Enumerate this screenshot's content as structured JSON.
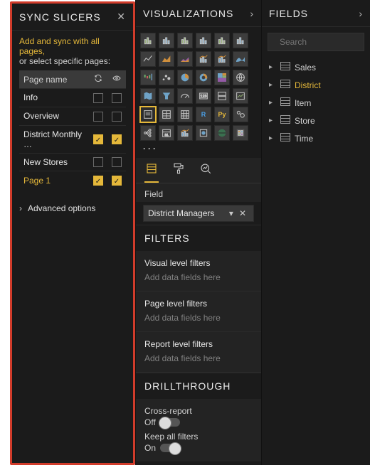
{
  "sync": {
    "title": "SYNC SLICERS",
    "hint1": "Add and sync with all pages,",
    "hint2": "or select specific pages:",
    "col_name": "Page name",
    "rows": [
      {
        "name": "Info",
        "sync": false,
        "visible": false,
        "current": false
      },
      {
        "name": "Overview",
        "sync": false,
        "visible": false,
        "current": false
      },
      {
        "name": "District Monthly …",
        "sync": true,
        "visible": true,
        "current": false
      },
      {
        "name": "New Stores",
        "sync": false,
        "visible": false,
        "current": false
      },
      {
        "name": "Page 1",
        "sync": true,
        "visible": true,
        "current": true
      }
    ],
    "advanced": "Advanced options"
  },
  "viz": {
    "title": "VISUALIZATIONS",
    "section_fields_tab": "Field",
    "field_chip": "District Managers",
    "filters_title": "FILTERS",
    "visual_filters": "Visual level filters",
    "page_filters": "Page level filters",
    "report_filters": "Report level filters",
    "add_placeholder": "Add data fields here",
    "drill_title": "DRILLTHROUGH",
    "cross_report": "Cross-report",
    "cross_report_val": "Off",
    "keep_filters": "Keep all filters",
    "keep_filters_val": "On",
    "icons": [
      "stacked-bar",
      "stacked-column",
      "clustered-bar",
      "clustered-column",
      "100-bar",
      "100-column",
      "line",
      "area",
      "stacked-area",
      "line-stacked",
      "line-clustered",
      "ribbon",
      "waterfall",
      "scatter",
      "pie",
      "donut",
      "treemap",
      "map",
      "filled-map",
      "funnel",
      "gauge",
      "card",
      "multi-row-card",
      "kpi",
      "slicer",
      "table",
      "matrix",
      "r-visual",
      "python-visual",
      "key-influencers",
      "decomposition",
      "calendar",
      "line-chart-2",
      "shape",
      "arcgis",
      "custom-visual"
    ],
    "selected_icon_index": 24
  },
  "fields": {
    "title": "FIELDS",
    "search_placeholder": "Search",
    "tables": [
      {
        "name": "Sales",
        "selected": false
      },
      {
        "name": "District",
        "selected": true
      },
      {
        "name": "Item",
        "selected": false
      },
      {
        "name": "Store",
        "selected": false
      },
      {
        "name": "Time",
        "selected": false
      }
    ]
  },
  "colors": {
    "accent": "#e5b83a",
    "panel": "#1b1b1b"
  }
}
